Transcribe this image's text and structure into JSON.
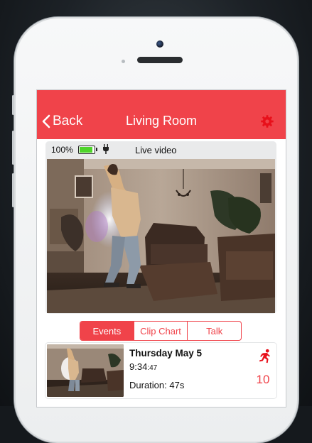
{
  "navbar": {
    "back_label": "Back",
    "title": "Living Room",
    "accent_color": "#f0434a",
    "gear_icon": "gear-icon"
  },
  "video": {
    "battery_percent_label": "100%",
    "battery_level": 1.0,
    "plug_icon": "plug-icon",
    "live_label": "Live video"
  },
  "tabs": [
    {
      "label": "Events",
      "active": true
    },
    {
      "label": "Clip Chart",
      "active": false
    },
    {
      "label": "Talk",
      "active": false
    }
  ],
  "events": [
    {
      "date": "Thursday May 5",
      "time_main": "9:34",
      "time_seconds": ":47",
      "duration": "Duration: 47s",
      "count": "10",
      "icon": "running-person-icon"
    }
  ]
}
